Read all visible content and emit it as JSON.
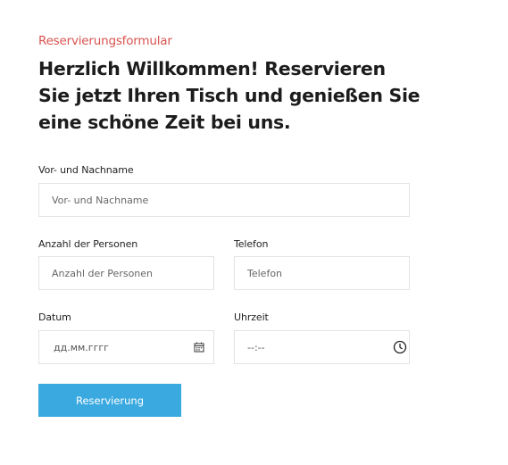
{
  "form": {
    "eyebrow": "Reservierungsformular",
    "headline": "Herzlich Willkommen! Reservieren Sie jetzt Ihren Tisch und genießen Sie eine schöne Zeit bei uns.",
    "name": {
      "label": "Vor- und Nachname",
      "placeholder": "Vor- und Nachname",
      "value": ""
    },
    "persons": {
      "label": "Anzahl der Personen",
      "placeholder": "Anzahl der Personen",
      "value": ""
    },
    "phone": {
      "label": "Telefon",
      "placeholder": "Telefon",
      "value": ""
    },
    "date": {
      "label": "Datum",
      "placeholder": "дд.мм.гггг",
      "icon": "calendar-icon"
    },
    "time": {
      "label": "Uhrzeit",
      "placeholder": "--:--",
      "icon": "clock-icon"
    },
    "submit_label": "Reservierung"
  },
  "colors": {
    "accent": "#d9534f",
    "button": "#3aa9e0",
    "border": "#e3e3e3"
  }
}
